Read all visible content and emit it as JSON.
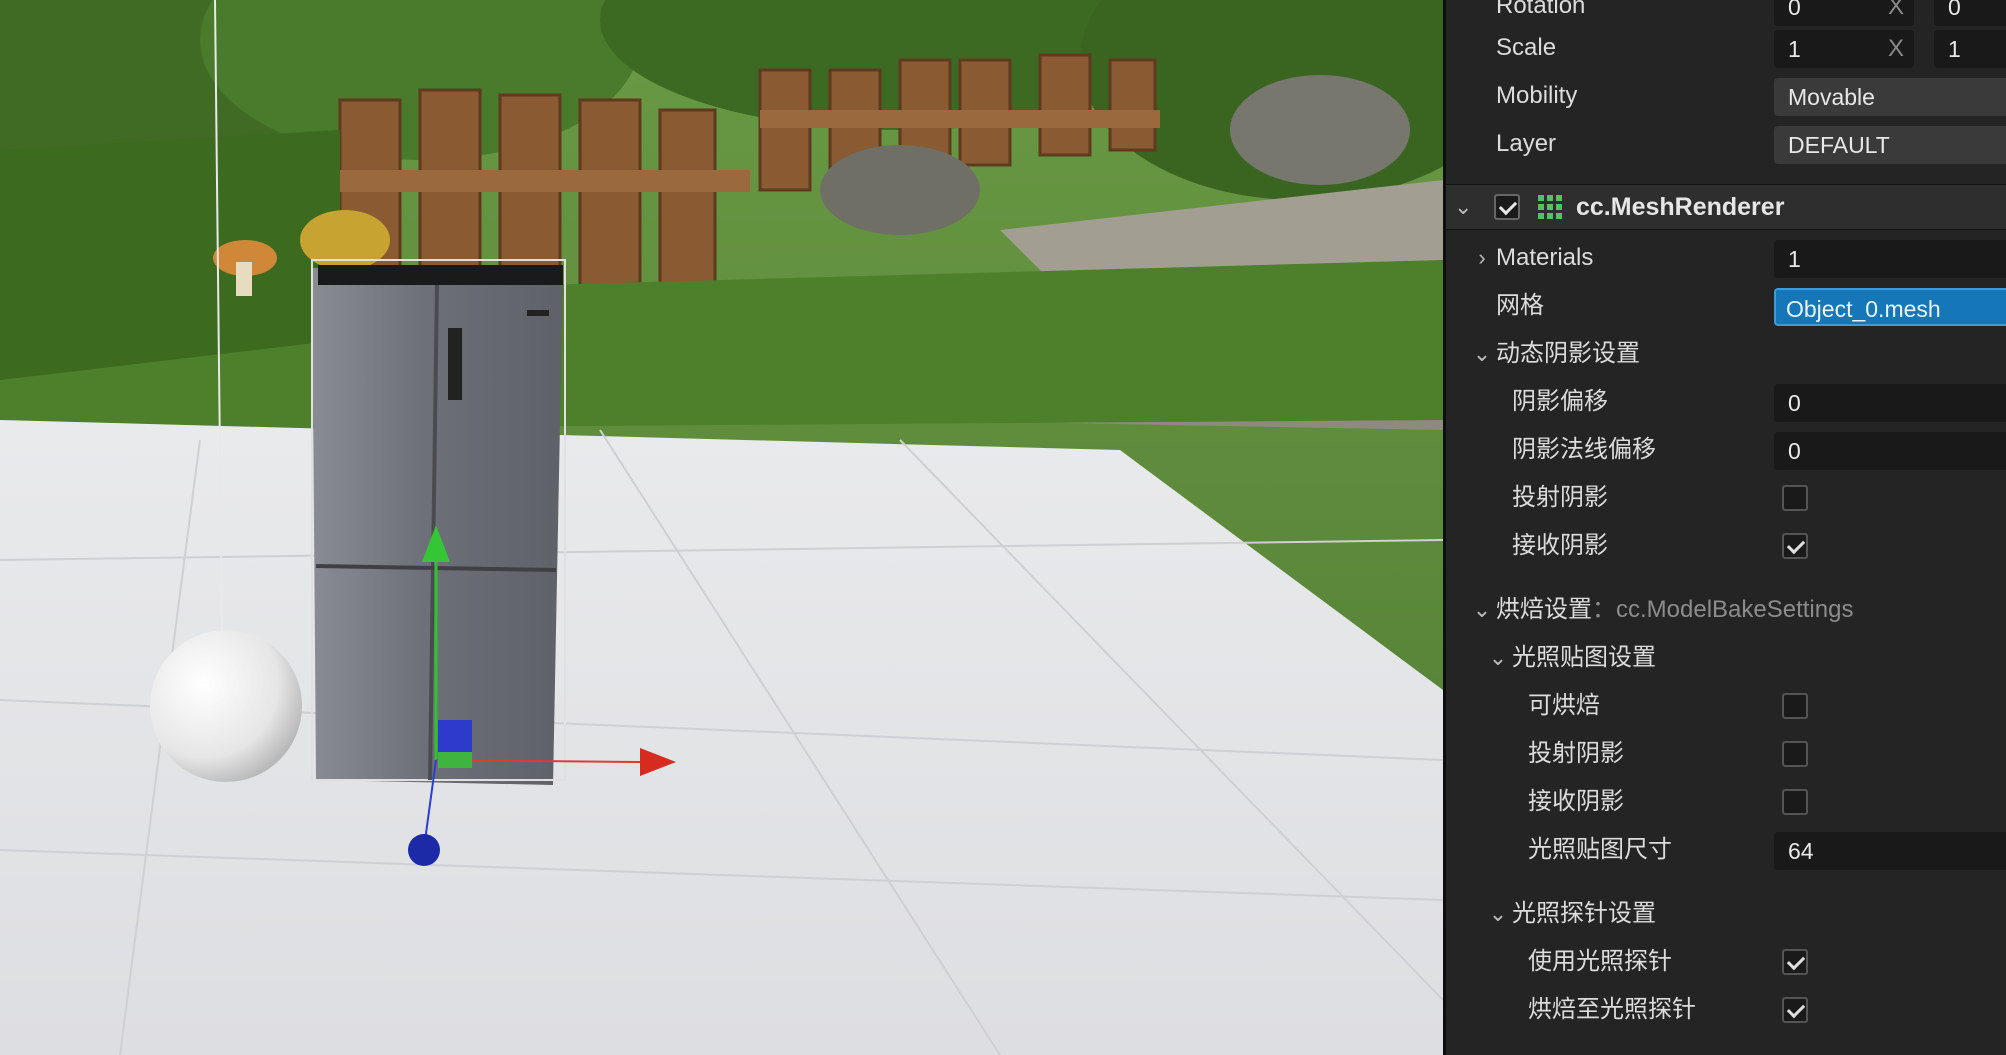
{
  "transform": {
    "rotation": {
      "label": "Rotation",
      "x": "0",
      "x_axis": "X",
      "y": "0"
    },
    "scale": {
      "label": "Scale",
      "x": "1",
      "x_axis": "X",
      "y": "1"
    },
    "mobility": {
      "label": "Mobility",
      "value": "Movable"
    },
    "layer": {
      "label": "Layer",
      "value": "DEFAULT"
    }
  },
  "mesh_renderer": {
    "title": "cc.MeshRenderer",
    "enabled": true,
    "materials": {
      "label": "Materials",
      "value": "1"
    },
    "mesh": {
      "label": "网格",
      "value": "Object_0.mesh"
    },
    "dynamic_shadow": {
      "label": "动态阴影设置",
      "shadow_bias": {
        "label": "阴影偏移",
        "value": "0"
      },
      "shadow_normal_bias": {
        "label": "阴影法线偏移",
        "value": "0"
      },
      "cast_shadow": {
        "label": "投射阴影",
        "checked": false
      },
      "receive_shadow": {
        "label": "接收阴影",
        "checked": true
      }
    },
    "bake": {
      "label": "烘焙设置",
      "type_sep": "：",
      "type": "cc.ModelBakeSettings",
      "lightmap": {
        "label": "光照贴图设置",
        "bakeable": {
          "label": "可烘焙",
          "checked": false
        },
        "cast_shadow": {
          "label": "投射阴影",
          "checked": false
        },
        "receive_shadow": {
          "label": "接收阴影",
          "checked": false
        },
        "lightmap_size": {
          "label": "光照贴图尺寸",
          "value": "64"
        }
      },
      "light_probe": {
        "label": "光照探针设置",
        "use_probe": {
          "label": "使用光照探针",
          "checked": true
        },
        "bake_to_probe": {
          "label": "烘焙至光照探针",
          "checked": true
        }
      }
    }
  },
  "icons": {
    "expand": "chevron-down-icon",
    "collapse": "chevron-right-icon",
    "component": "grid-icon"
  }
}
